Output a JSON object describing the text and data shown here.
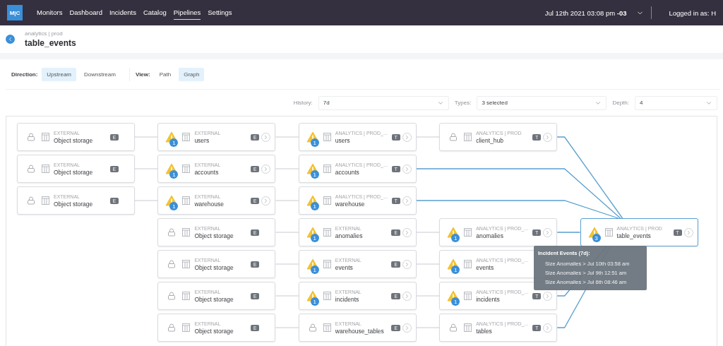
{
  "nav": {
    "logo": "M|C",
    "items": [
      {
        "label": "Monitors",
        "selected": false
      },
      {
        "label": "Dashboard",
        "selected": false
      },
      {
        "label": "Incidents",
        "selected": false
      },
      {
        "label": "Catalog",
        "selected": false
      },
      {
        "label": "Pipelines",
        "selected": true
      },
      {
        "label": "Settings",
        "selected": false
      }
    ],
    "datetime": "Jul 12th 2021 03:08 pm **-03**",
    "user": "Logged in as: H"
  },
  "header": {
    "breadcrumb": "analytics | prod",
    "title": "table_events"
  },
  "controls": [
    {
      "label": "Direction:",
      "options": [
        {
          "label": "Upstream",
          "selected": true
        },
        {
          "label": "Downstream",
          "selected": false
        }
      ]
    },
    {
      "label": "View:",
      "options": [
        {
          "label": "Path",
          "selected": false
        },
        {
          "label": "Graph",
          "selected": true
        }
      ]
    }
  ],
  "filters": [
    {
      "label": "History:",
      "value": "7d"
    },
    {
      "label": "Types:",
      "value": "3 selected"
    },
    {
      "label": "Depth:",
      "value": "4"
    }
  ],
  "graph": {
    "columns": [
      {
        "rows": [
          {
            "kind": "locked",
            "schema": "EXTERNAL",
            "name": "Object storage",
            "badge": "E",
            "expandable": false,
            "selected": false,
            "edge_next": true,
            "edge_to_target": false
          },
          {
            "kind": "locked",
            "schema": "EXTERNAL",
            "name": "Object storage",
            "badge": "E",
            "expandable": false,
            "selected": false,
            "edge_next": true,
            "edge_to_target": false
          },
          {
            "kind": "locked",
            "schema": "EXTERNAL",
            "name": "Object storage",
            "badge": "E",
            "expandable": false,
            "selected": false,
            "edge_next": true,
            "edge_to_target": false
          }
        ]
      },
      {
        "rows": [
          {
            "kind": "warning",
            "count": "1",
            "schema": "EXTERNAL",
            "name": "users",
            "badge": "E",
            "expandable": true,
            "selected": false,
            "edge_next": true,
            "edge_to_target": false
          },
          {
            "kind": "warning",
            "count": "1",
            "schema": "EXTERNAL",
            "name": "accounts",
            "badge": "E",
            "expandable": true,
            "selected": false,
            "edge_next": true,
            "edge_to_target": false
          },
          {
            "kind": "warning",
            "count": "1",
            "schema": "EXTERNAL",
            "name": "warehouse",
            "badge": "E",
            "expandable": true,
            "selected": false,
            "edge_next": true,
            "edge_to_target": false
          },
          {
            "kind": "locked",
            "schema": "EXTERNAL",
            "name": "Object storage",
            "badge": "E",
            "expandable": false,
            "selected": false,
            "edge_next": true,
            "edge_to_target": false
          },
          {
            "kind": "locked",
            "schema": "EXTERNAL",
            "name": "Object storage",
            "badge": "E",
            "expandable": false,
            "selected": false,
            "edge_next": true,
            "edge_to_target": false
          },
          {
            "kind": "locked",
            "schema": "EXTERNAL",
            "name": "Object storage",
            "badge": "E",
            "expandable": false,
            "selected": false,
            "edge_next": true,
            "edge_to_target": false
          },
          {
            "kind": "locked",
            "schema": "EXTERNAL",
            "name": "Object storage",
            "badge": "E",
            "expandable": false,
            "selected": false,
            "edge_next": true,
            "edge_to_target": false
          }
        ]
      },
      {
        "rows": [
          {
            "kind": "warning",
            "count": "1",
            "schema": "ANALYTICS | PROD_...",
            "name": "users",
            "badge": "T",
            "expandable": true,
            "selected": false,
            "edge_next": true,
            "edge_to_target": false
          },
          {
            "kind": "warning",
            "count": "1",
            "schema": "ANALYTICS | PROD_...",
            "name": "accounts",
            "badge": "T",
            "expandable": true,
            "selected": false,
            "edge_next": false,
            "edge_to_target": true
          },
          {
            "kind": "warning",
            "count": "1",
            "schema": "ANALYTICS | PROD_...",
            "name": "warehouse",
            "badge": "T",
            "expandable": true,
            "selected": false,
            "edge_next": false,
            "edge_to_target": true
          },
          {
            "kind": "warning",
            "count": "1",
            "schema": "EXTERNAL",
            "name": "anomalies",
            "badge": "E",
            "expandable": true,
            "selected": false,
            "edge_next": true,
            "edge_to_target": false
          },
          {
            "kind": "warning",
            "count": "1",
            "schema": "EXTERNAL",
            "name": "events",
            "badge": "E",
            "expandable": true,
            "selected": false,
            "edge_next": true,
            "edge_to_target": false
          },
          {
            "kind": "warning",
            "count": "1",
            "schema": "EXTERNAL",
            "name": "incidents",
            "badge": "E",
            "expandable": true,
            "selected": false,
            "edge_next": true,
            "edge_to_target": false
          },
          {
            "kind": "locked",
            "schema": "EXTERNAL",
            "name": "warehouse_tables",
            "badge": "E",
            "expandable": true,
            "selected": false,
            "edge_next": true,
            "edge_to_target": false
          }
        ]
      },
      {
        "rows": [
          {
            "kind": "locked",
            "schema": "ANALYTICS | PROD",
            "name": "client_hub",
            "badge": "T",
            "expandable": true,
            "selected": false,
            "edge_next": false,
            "edge_to_target": true
          },
          null,
          null,
          {
            "kind": "warning",
            "count": "1",
            "schema": "ANALYTICS | PROD_...",
            "name": "anomalies",
            "badge": "T",
            "expandable": true,
            "selected": false,
            "edge_next": false,
            "edge_to_target": true
          },
          {
            "kind": "warning",
            "count": "1",
            "schema": "ANALYTICS | PROD_...",
            "name": "events",
            "selected": false,
            "edge_next": false,
            "edge_to_target": false
          },
          {
            "kind": "warning",
            "count": "1",
            "schema": "ANALYTICS | PROD_...",
            "name": "incidents",
            "badge": "T",
            "expandable": true,
            "selected": false,
            "edge_next": false,
            "edge_to_target": true
          },
          {
            "kind": "locked",
            "schema": "ANALYTICS | PROD_...",
            "name": "tables",
            "badge": "T",
            "expandable": true,
            "selected": false,
            "edge_next": false,
            "edge_to_target": true
          }
        ]
      },
      {
        "rows": [
          null,
          null,
          null,
          {
            "kind": "warning",
            "count": "3",
            "schema": "ANALYTICS | PROD",
            "name": "table_events",
            "badge": "T",
            "expandable": true,
            "selected": true,
            "edge_next": false,
            "edge_to_target": false
          }
        ]
      }
    ],
    "tooltip": {
      "title": "Incident Events (7d):",
      "lines": [
        "Size Anomalies > Jul 10th 03:58 am",
        "Size Anomalies > Jul 9th 12:51 am",
        "Size Anomalies > Jul 6th 08:46 am"
      ]
    }
  }
}
